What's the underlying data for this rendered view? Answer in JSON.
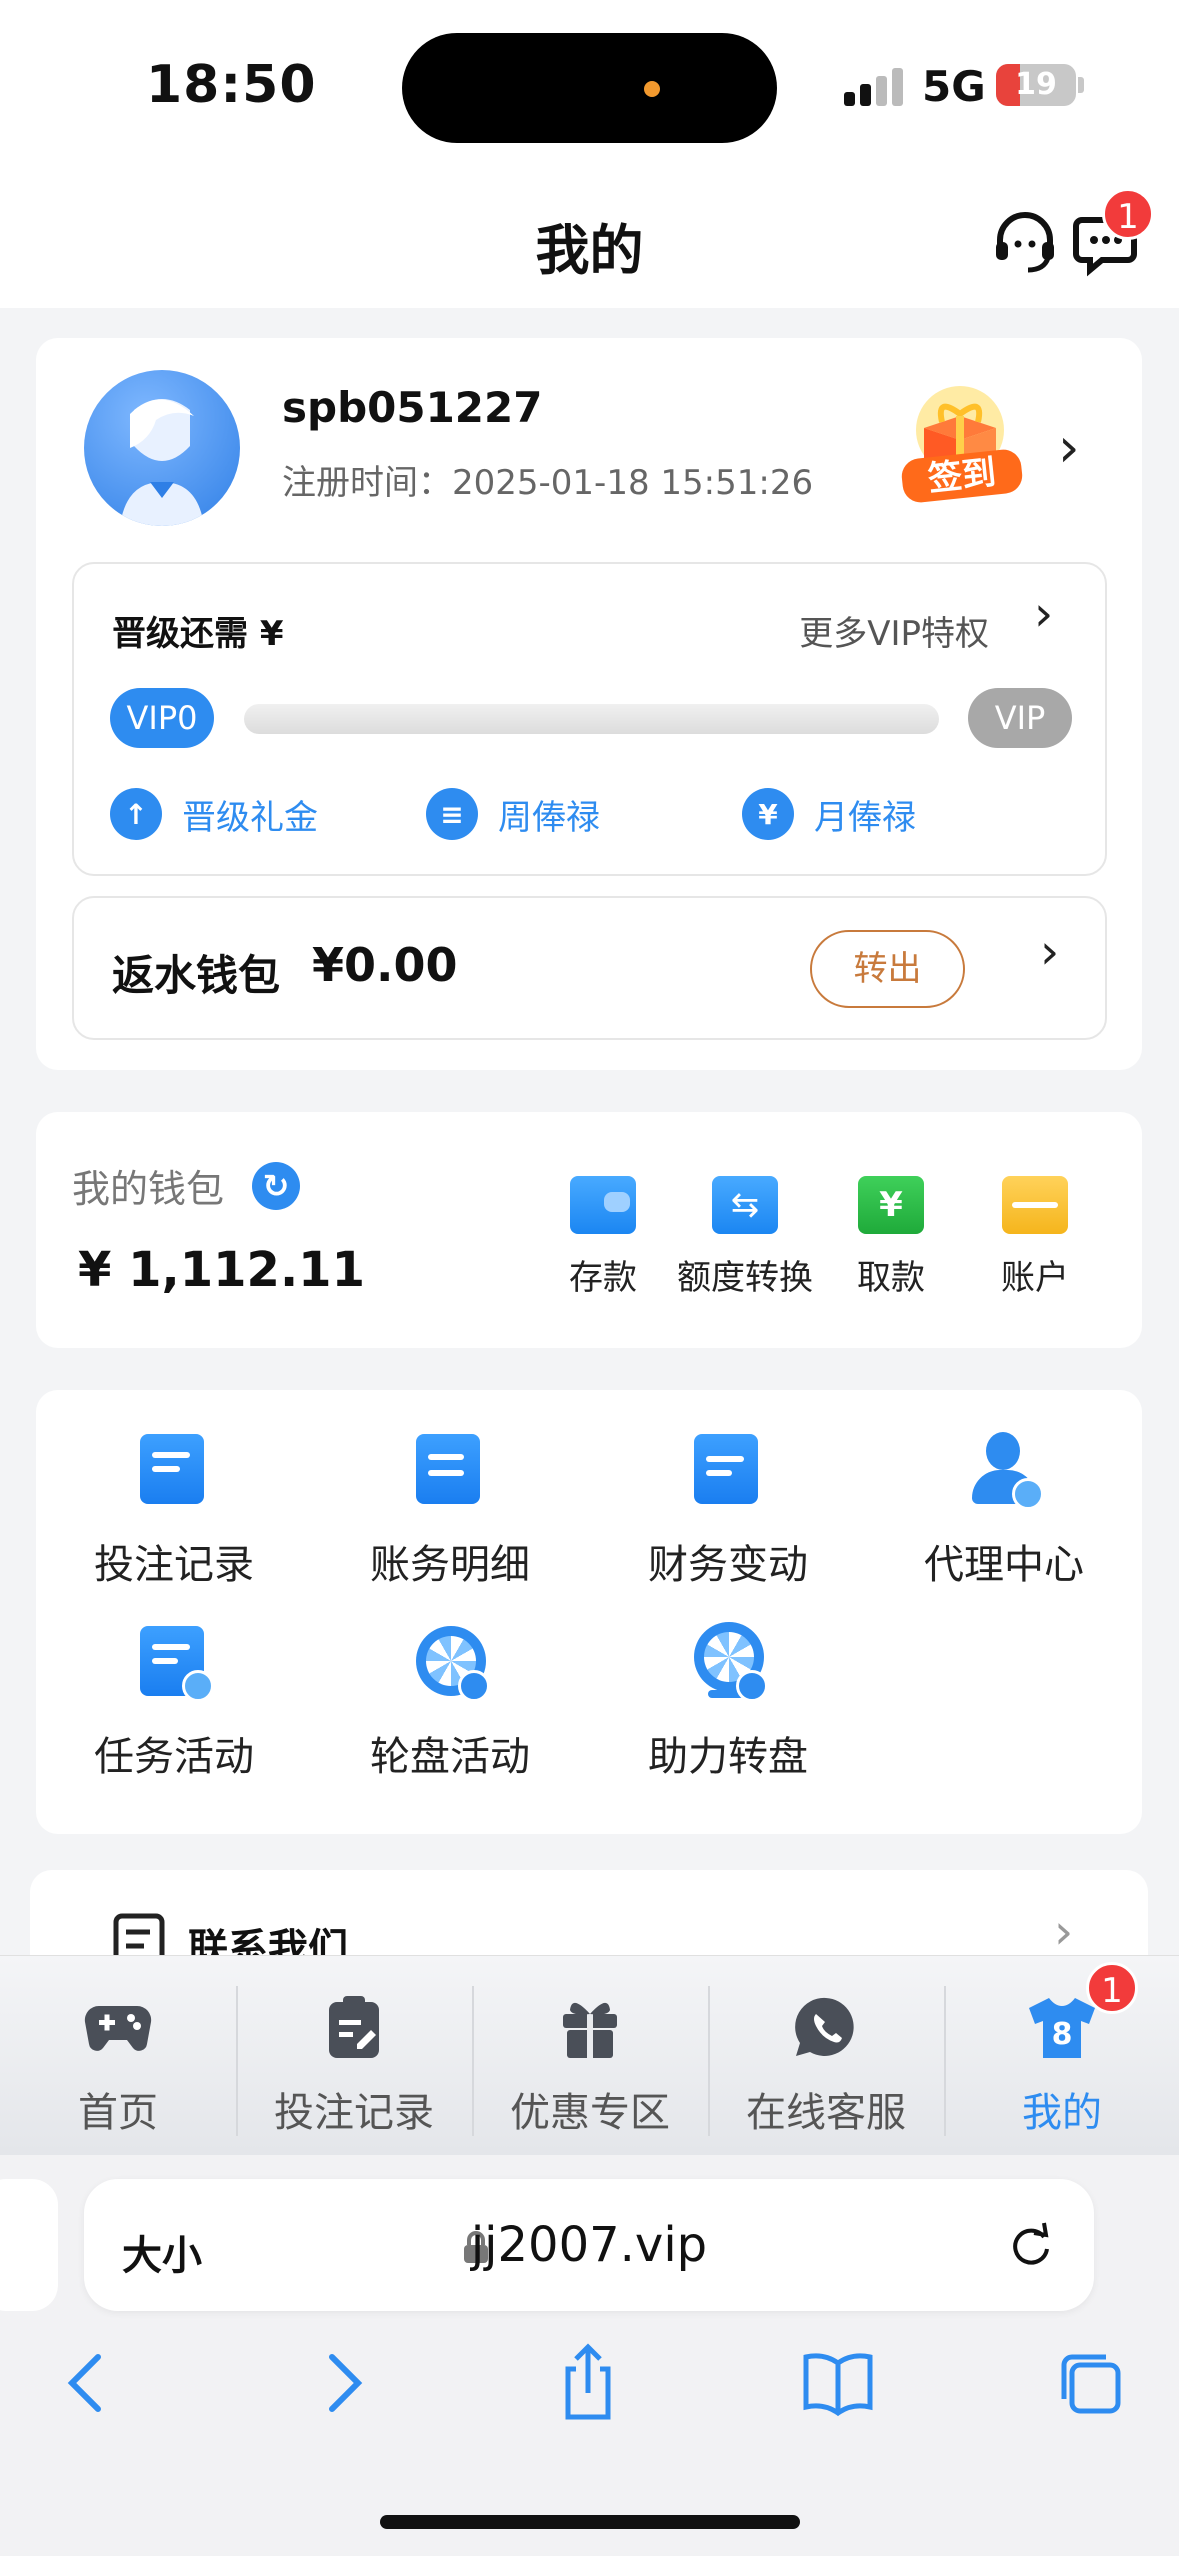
{
  "status_bar": {
    "time": "18:50",
    "network": "5G",
    "battery": "19"
  },
  "header": {
    "title": "我的",
    "message_badge": "1"
  },
  "profile": {
    "username": "spb051227",
    "register_time": "注册时间：2025-01-18 15:51:26",
    "signin_label": "签到"
  },
  "vip": {
    "upgrade_need": "晋级还需 ¥",
    "more_vip": "更多VIP特权",
    "current_level": "VIP0",
    "next_level": "VIP",
    "progress": 0,
    "perks": [
      "晋级礼金",
      "周俸禄",
      "月俸禄"
    ]
  },
  "rebate": {
    "label": "返水钱包",
    "amount": "¥0.00",
    "transfer": "转出"
  },
  "wallet": {
    "title": "我的钱包",
    "amount": "¥ 1,112.11",
    "actions": [
      "存款",
      "额度转换",
      "取款",
      "账户"
    ]
  },
  "features": [
    "投注记录",
    "账务明细",
    "财务变动",
    "代理中心",
    "任务活动",
    "轮盘活动",
    "助力转盘"
  ],
  "contact": {
    "label": "联系我们"
  },
  "tabbar": {
    "tabs": [
      "首页",
      "投注记录",
      "优惠专区",
      "在线客服",
      "我的"
    ],
    "badge": "1",
    "active": "我的"
  },
  "browser": {
    "text_size": "大小",
    "url": "jj2007.vip"
  },
  "colors": {
    "accent": "#2e8cf0",
    "badge": "#f23b3b",
    "transfer": "#c87a3c"
  }
}
